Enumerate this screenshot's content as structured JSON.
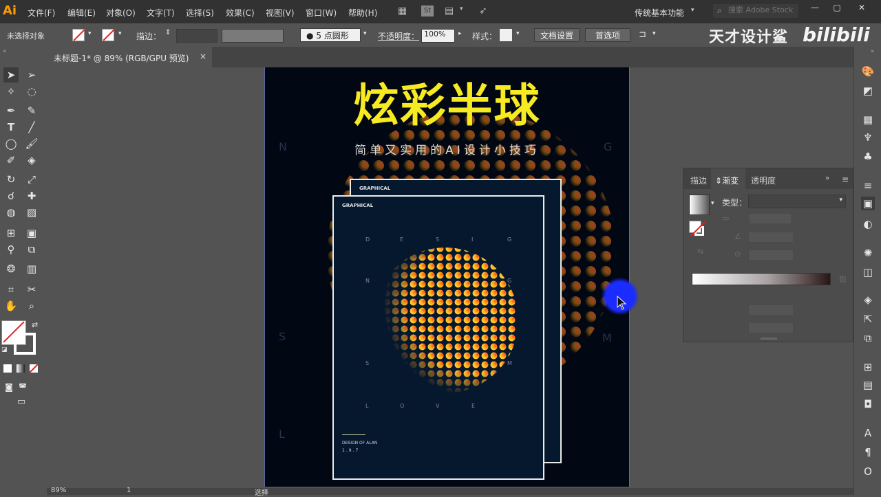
{
  "app": {
    "logo": "Ai"
  },
  "menu": [
    "文件(F)",
    "编辑(E)",
    "对象(O)",
    "文字(T)",
    "选择(S)",
    "效果(C)",
    "视图(V)",
    "窗口(W)",
    "帮助(H)"
  ],
  "menubar": {
    "workspace": "传统基本功能",
    "search_placeholder": "搜索 Adobe Stock"
  },
  "control": {
    "selection": "未选择对象",
    "stroke_label": "描边：",
    "brush": "5 点圆形",
    "opacity_label": "不透明度：",
    "opacity_value": "100%",
    "style_label": "样式：",
    "doc_setup": "文档设置",
    "prefs": "首选项"
  },
  "watermark": {
    "text": "天才设计鲨",
    "bili": "bilibili"
  },
  "tab": {
    "label": "未标题-1* @ 89% (RGB/GPU 预览)",
    "close": "×"
  },
  "poster": {
    "title": "炫彩半球",
    "subtitle": "简单又实用的AI设计小技巧",
    "side_letters": [
      "N",
      "G",
      "S",
      "M",
      "L"
    ],
    "back_card_label": "GRAPHICAL",
    "front_card_label": "GRAPHICAL",
    "card_letters": [
      "D",
      "E",
      "S",
      "I",
      "G",
      "N",
      "G",
      "S",
      "M",
      "L",
      "O",
      "V",
      "E"
    ],
    "footer_text": "DESIGN OF ALAN",
    "footer_num": "1.9.7"
  },
  "gradient_panel": {
    "tabs": [
      "描边",
      "渐变",
      "透明度"
    ],
    "type_label": "类型："
  },
  "status": {
    "zoom": "89%",
    "page": "1",
    "tool": "选择"
  }
}
